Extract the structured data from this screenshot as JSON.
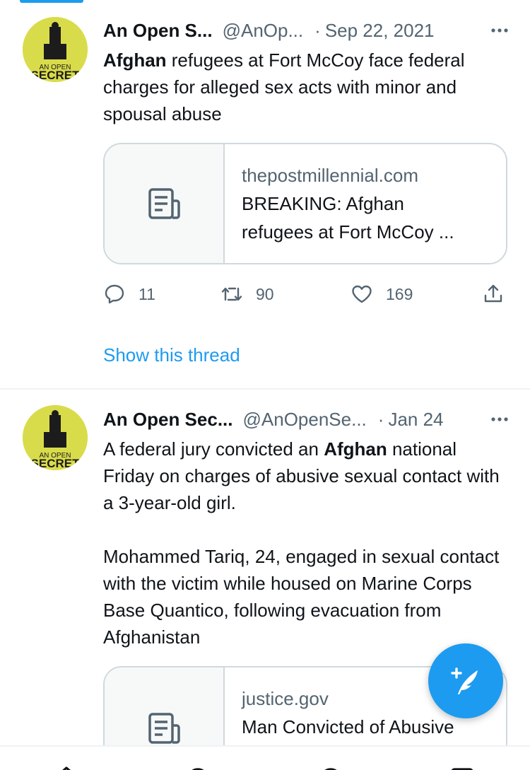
{
  "colors": {
    "accent": "#1d9bf0",
    "text_primary": "#0f1419",
    "text_secondary": "#536471",
    "border": "#cfd9de",
    "avatar_bg": "#d9dc4a"
  },
  "tweets": [
    {
      "author_name": "An Open S...",
      "handle": "@AnOp...",
      "separator": "·",
      "date": "Sep 22, 2021",
      "more_icon": "more-dots-icon",
      "avatar_text": [
        "AN OPEN",
        "SECRET"
      ],
      "text_bold_1": "Afghan",
      "text_rest_1": " refugees at Fort McCoy face federal charges for alleged sex acts with minor and spousal abuse",
      "card": {
        "icon": "article-icon",
        "domain": "thepostmillennial.com",
        "title_line_1": "BREAKING: Afghan",
        "title_line_2": "refugees at Fort McCoy ..."
      },
      "actions": {
        "reply_count": "11",
        "retweet_count": "90",
        "like_count": "169"
      },
      "show_thread": "Show this thread"
    },
    {
      "author_name": "An Open Sec...",
      "handle": "@AnOpenSe...",
      "separator": "·",
      "date": "Jan 24",
      "more_icon": "more-dots-icon",
      "avatar_text": [
        "AN OPEN",
        "SECRET"
      ],
      "text_plain_1": "A federal jury convicted an ",
      "text_bold_1": "Afghan",
      "text_rest_1": " national Friday on charges of abusive sexual contact with a 3-year-old girl.\n\nMohammed Tariq, 24, engaged in sexual contact with the victim while housed on Marine Corps Base Quantico, following evacuation from Afghanistan",
      "card": {
        "icon": "article-icon",
        "domain": "justice.gov",
        "title_line_1": "Man Convicted of Abusive"
      }
    }
  ],
  "fab": {
    "icon": "compose-tweet-icon"
  },
  "bottom_nav": [
    "home-icon",
    "explore-icon",
    "spaces-icon",
    "notifications-icon"
  ]
}
